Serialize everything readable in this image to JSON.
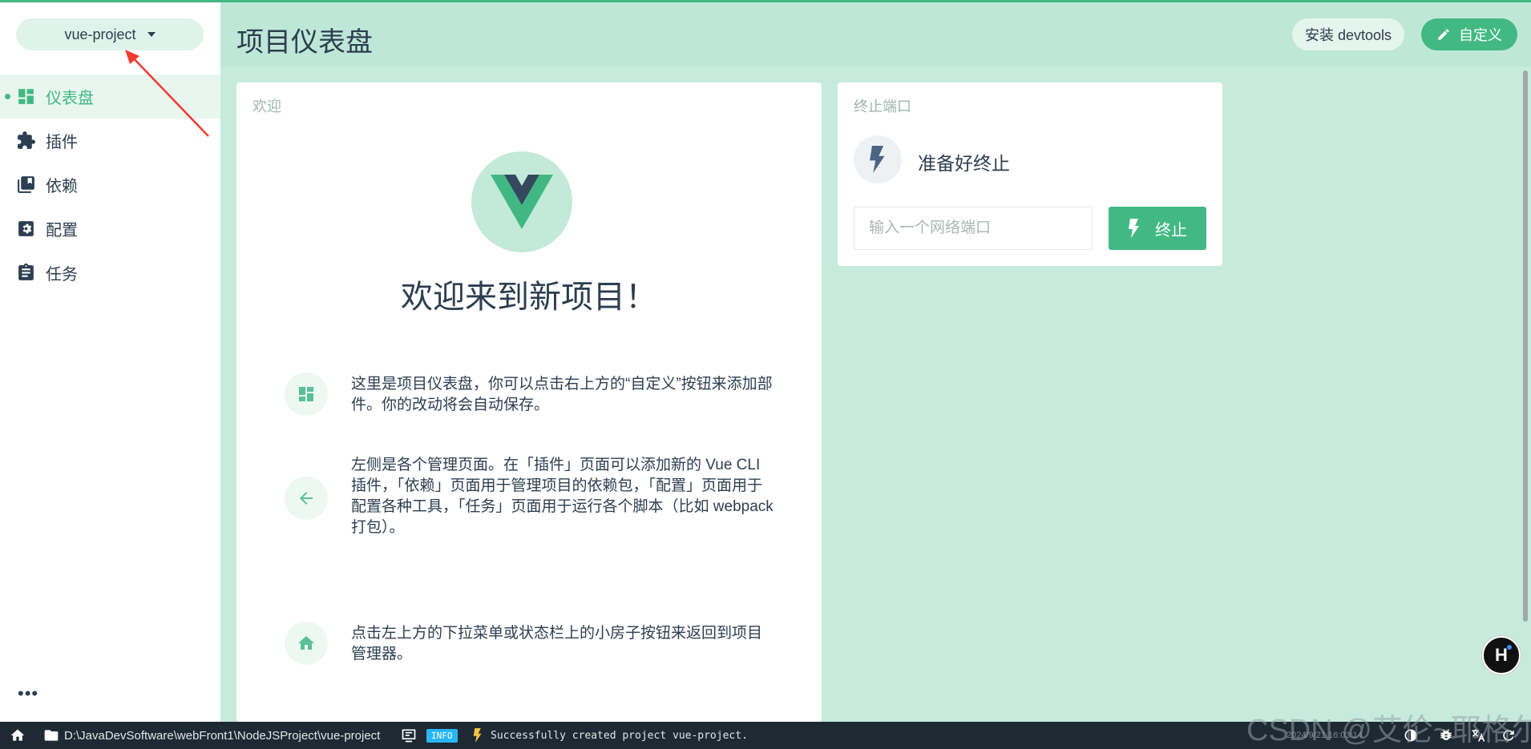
{
  "project": {
    "name": "vue-project"
  },
  "sidebar": {
    "items": [
      {
        "label": "仪表盘",
        "icon": "dashboard-icon",
        "active": true
      },
      {
        "label": "插件",
        "icon": "puzzle-icon",
        "active": false
      },
      {
        "label": "依赖",
        "icon": "library-books-icon",
        "active": false
      },
      {
        "label": "配置",
        "icon": "settings-icon",
        "active": false
      },
      {
        "label": "任务",
        "icon": "assignment-icon",
        "active": false
      }
    ],
    "more": "•••"
  },
  "header": {
    "title": "项目仪表盘",
    "devtools_label": "安装 devtools",
    "customize_label": "自定义"
  },
  "welcome": {
    "card_title": "欢迎",
    "heading": "欢迎来到新项目！",
    "tips": [
      {
        "icon": "dashboard-icon",
        "text": "这里是项目仪表盘，你可以点击右上方的“自定义”按钮来添加部件。你的改动将会自动保存。"
      },
      {
        "icon": "arrow-left-icon",
        "text": "左侧是各个管理页面。在「插件」页面可以添加新的 Vue CLI 插件，「依赖」页面用于管理项目的依赖包，「配置」页面用于配置各种工具，「任务」页面用于运行各个脚本（比如 webpack 打包）。"
      },
      {
        "icon": "home-icon",
        "text": "点击左上方的下拉菜单或状态栏上的小房子按钮来返回到项目管理器。"
      }
    ]
  },
  "kill_port": {
    "card_title": "终止端口",
    "status": "准备好终止",
    "placeholder": "输入一个网络端口",
    "button_label": "终止"
  },
  "statusbar": {
    "path": "D:\\JavaDevSoftware\\webFront1\\NodeJSProject\\vue-project",
    "log_level": "INFO",
    "log_message": "Successfully created project vue-project.",
    "timestamp": "2024/9/21 16:03:14"
  },
  "watermark": "CSDN @艾伦~耶格尔",
  "colors": {
    "accent": "#42b983",
    "background": "#c6ebdd",
    "statusbar": "#1e2a33"
  }
}
